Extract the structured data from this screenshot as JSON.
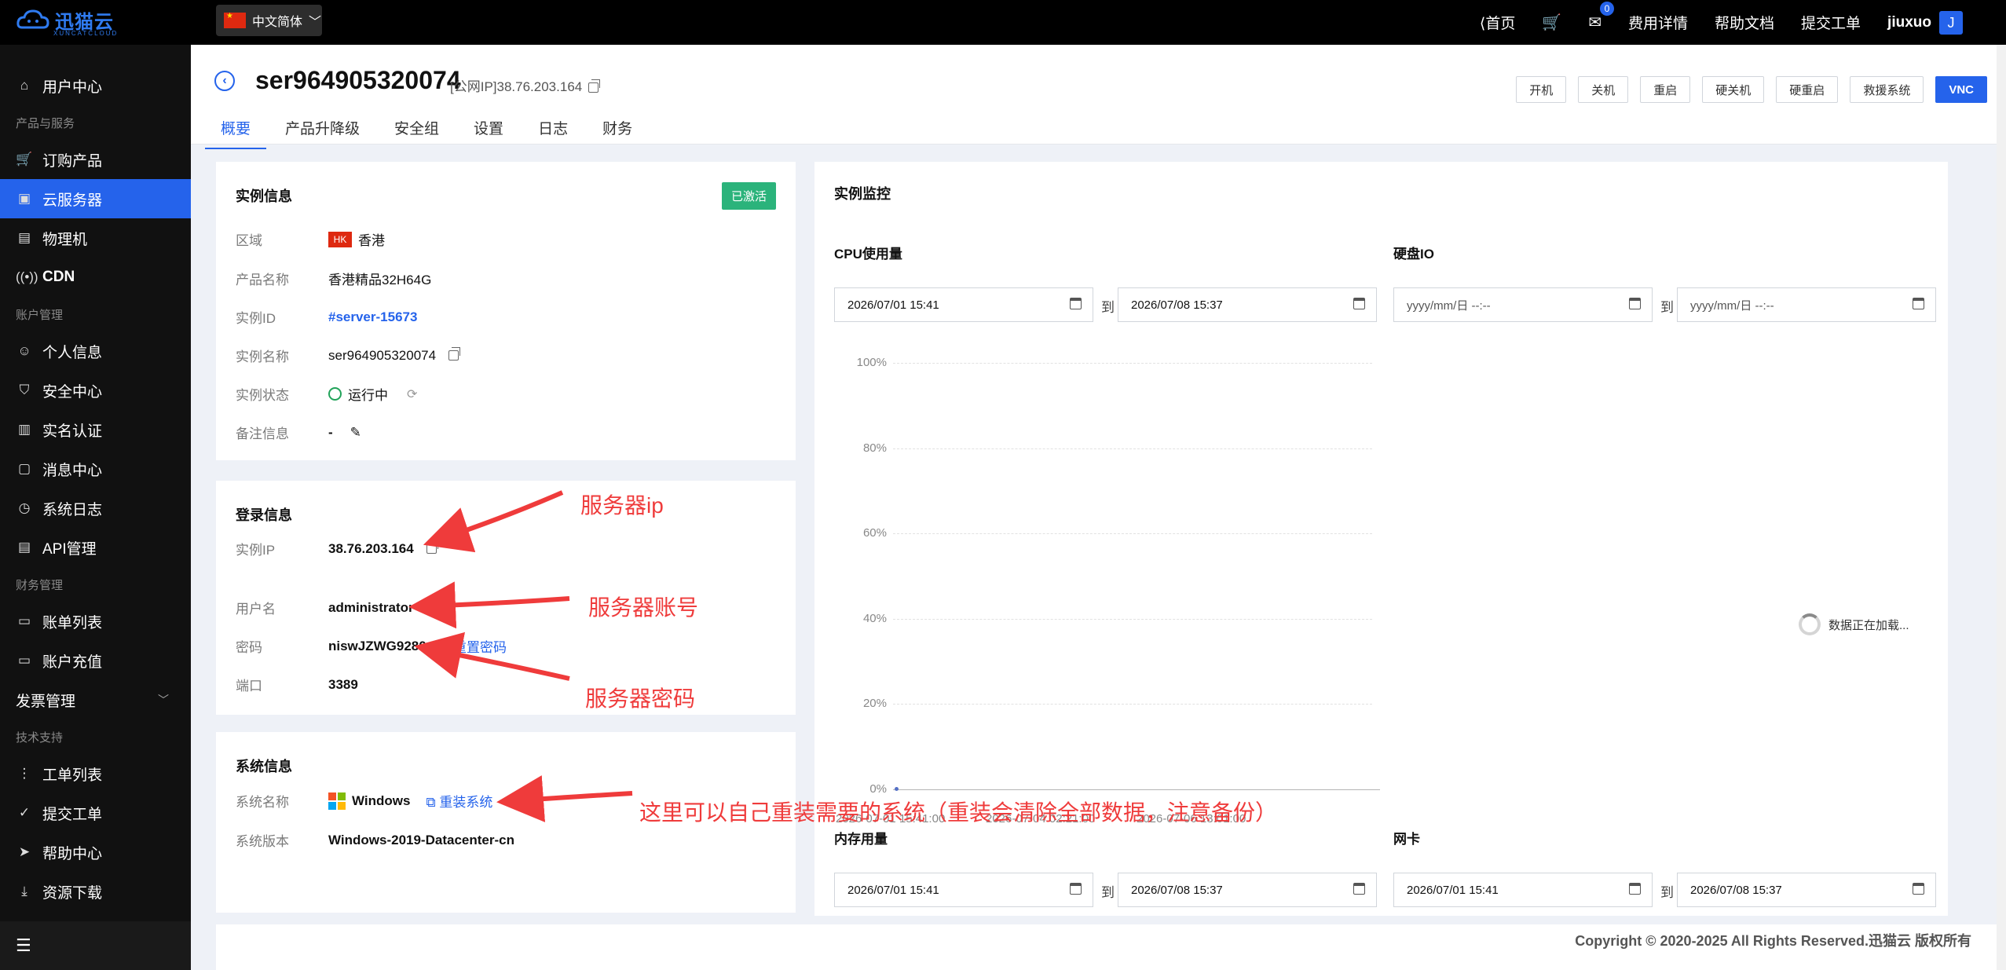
{
  "brand": {
    "name": "迅猫云",
    "sub": "XUNCATCLOUD"
  },
  "topbar": {
    "language": "中文简体",
    "home": "首页",
    "message_count": "0",
    "billing": "费用详情",
    "docs": "帮助文档",
    "ticket": "提交工单",
    "username": "jiuxuo",
    "avatar_letter": "J"
  },
  "sidebar": {
    "user_center": "用户中心",
    "group_products": "产品与服务",
    "order_products": "订购产品",
    "cloud_server": "云服务器",
    "physical": "物理机",
    "cdn": "CDN",
    "group_account": "账户管理",
    "profile": "个人信息",
    "security": "安全中心",
    "realname": "实名认证",
    "messages": "消息中心",
    "syslog": "系统日志",
    "api": "API管理",
    "group_finance": "财务管理",
    "bills": "账单列表",
    "recharge": "账户充值",
    "invoice": "发票管理",
    "group_support": "技术支持",
    "tickets": "工单列表",
    "submit_ticket": "提交工单",
    "help": "帮助中心",
    "downloads": "资源下载"
  },
  "header": {
    "instance_name": "ser964905320074",
    "public_ip": "[公网IP]38.76.203.164",
    "tabs": [
      "概要",
      "产品升降级",
      "安全组",
      "设置",
      "日志",
      "财务"
    ],
    "actions": [
      "开机",
      "关机",
      "重启",
      "硬关机",
      "硬重启",
      "救援系统",
      "VNC"
    ]
  },
  "instance_info": {
    "title": "实例信息",
    "status_badge": "已激活",
    "region_label": "区域",
    "region_flag": "HK",
    "region": "香港",
    "product_label": "产品名称",
    "product": "香港精品32H64G",
    "id_label": "实例ID",
    "id": "#server-15673",
    "name_label": "实例名称",
    "name": "ser964905320074",
    "state_label": "实例状态",
    "state": "运行中",
    "remark_label": "备注信息",
    "remark": "-"
  },
  "login_info": {
    "title": "登录信息",
    "ip_label": "实例IP",
    "ip": "38.76.203.164",
    "user_label": "用户名",
    "user": "administrator",
    "pwd_label": "密码",
    "pwd": "niswJZWG9280",
    "reset_pwd": "重置密码",
    "port_label": "端口",
    "port": "3389"
  },
  "system_info": {
    "title": "系统信息",
    "os_label": "系统名称",
    "os": "Windows",
    "reinstall": "重装系统",
    "ver_label": "系统版本",
    "version": "Windows-2019-Datacenter-cn"
  },
  "monitor": {
    "title": "实例监控",
    "cpu_title": "CPU使用量",
    "disk_title": "硬盘IO",
    "mem_title": "内存用量",
    "net_title": "网卡",
    "to": "到",
    "date_start": "2026/07/01 15:41",
    "date_end": "2026/07/08 15:37",
    "date_placeholder": "yyyy/mm/日 --:--",
    "loading": "数据正在加载..."
  },
  "chart_data": {
    "type": "line",
    "title": "CPU使用量",
    "x": [
      "2026-07-01 15:41:00",
      "2026-07-04 02:21:00",
      "2026-07-06 13:01:00"
    ],
    "y_ticks": [
      "0%",
      "20%",
      "40%",
      "60%",
      "80%",
      "100%"
    ],
    "ylim": [
      0,
      100
    ],
    "series": [
      {
        "values": [
          0,
          0,
          0
        ]
      }
    ],
    "grid": true
  },
  "annotations": {
    "ip": "服务器ip",
    "account": "服务器账号",
    "password": "服务器密码",
    "reinstall": "这里可以自己重装需要的系统（重装会清除全部数据，注意备份）"
  },
  "footer": "Copyright © 2020-2025 All Rights Reserved.迅猫云 版权所有"
}
